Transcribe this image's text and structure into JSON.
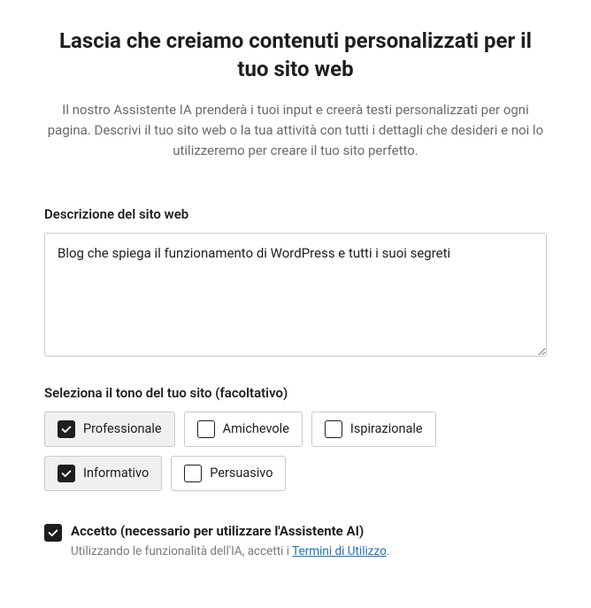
{
  "header": {
    "title": "Lascia che creiamo contenuti personalizzati per il tuo sito web",
    "subtitle": "Il nostro Assistente IA prenderà i tuoi input e creerà testi personalizzati per ogni pagina. Descrivi il tuo sito web o la tua attività con tutti i dettagli che desideri e noi lo utilizzeremo per creare il tuo sito perfetto."
  },
  "description": {
    "label": "Descrizione del sito web",
    "value": "Blog che spiega il funzionamento di WordPress e tutti i suoi segreti"
  },
  "tone": {
    "label": "Seleziona il tono del tuo sito (facoltativo)",
    "options": {
      "professional": "Professionale",
      "friendly": "Amichevole",
      "inspirational": "Ispirazionale",
      "informative": "Informativo",
      "persuasive": "Persuasivo"
    }
  },
  "accept": {
    "label": "Accetto (necessario per utilizzare l'Assistente AI)",
    "sub_prefix": "Utilizzando le funzionalità dell'IA, accetti i ",
    "link_text": "Termini di Utilizzo",
    "sub_suffix": "."
  }
}
